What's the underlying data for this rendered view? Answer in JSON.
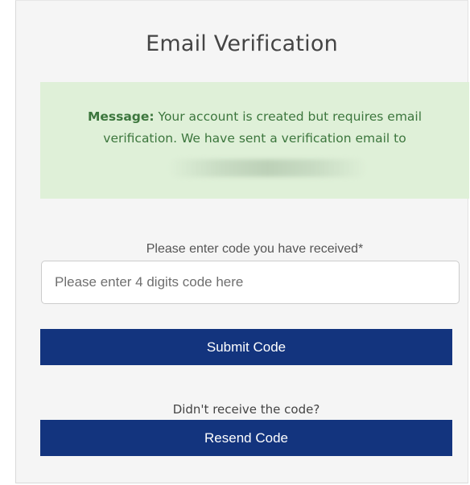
{
  "card": {
    "title": "Email Verification"
  },
  "message": {
    "label": "Message:",
    "text_line1": " Your account is created but requires email",
    "text_line2": "verification. We have sent a verification email to"
  },
  "form": {
    "code_label": "Please enter code you have received*",
    "code_placeholder": "Please enter 4 digits code here",
    "code_value": "",
    "submit_label": "Submit Code",
    "resend_prompt": "Didn't receive the code?",
    "resend_label": "Resend Code"
  },
  "colors": {
    "button_bg": "#13347e",
    "message_bg": "#dff0d8",
    "message_text": "#3c763d"
  }
}
